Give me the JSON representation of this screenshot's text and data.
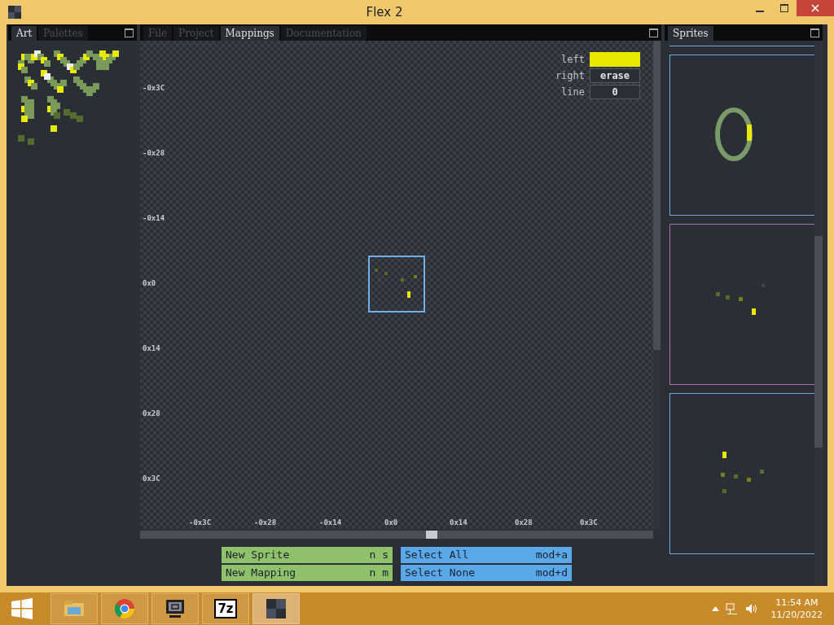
{
  "window": {
    "title": "Flex 2"
  },
  "left_panel": {
    "tabs": [
      {
        "label": "Art",
        "selected": true
      },
      {
        "label": "Palettes",
        "selected": false
      }
    ]
  },
  "center_panel": {
    "tabs": [
      {
        "label": "File",
        "selected": false
      },
      {
        "label": "Project",
        "selected": false
      },
      {
        "label": "Mappings",
        "selected": true
      },
      {
        "label": "Documentation",
        "selected": false
      }
    ],
    "y_axis_labels": [
      "-0x3C",
      "-0x28",
      "-0x14",
      "0x0",
      "0x14",
      "0x28",
      "0x3C"
    ],
    "x_axis_labels": [
      "-0x3C",
      "-0x28",
      "-0x14",
      "0x0",
      "0x14",
      "0x28",
      "0x3C"
    ],
    "brush": [
      {
        "label": "left",
        "kind": "color",
        "color": "#e8e800"
      },
      {
        "label": "right",
        "kind": "text",
        "value": "erase"
      },
      {
        "label": "line",
        "kind": "text",
        "value": "0"
      }
    ],
    "actions": [
      {
        "label": "New Sprite",
        "shortcut": "n s",
        "color": "#8fc06a"
      },
      {
        "label": "Select All",
        "shortcut": "mod+a",
        "color": "#5aa8e8"
      },
      {
        "label": "New Mapping",
        "shortcut": "n m",
        "color": "#8fc06a"
      },
      {
        "label": "Select None",
        "shortcut": "mod+d",
        "color": "#5aa8e8"
      }
    ]
  },
  "right_panel": {
    "tabs": [
      {
        "label": "Sprites",
        "selected": true
      }
    ],
    "sprites": [
      {
        "selected": false
      },
      {
        "selected": true
      },
      {
        "selected": false
      }
    ]
  },
  "taskbar": {
    "apps": [
      {
        "kind": "folder",
        "selected": false
      },
      {
        "kind": "browser",
        "selected": false
      },
      {
        "kind": "monitor",
        "selected": false
      },
      {
        "kind": "archiver",
        "label": "7z",
        "selected": false
      },
      {
        "kind": "flex",
        "selected": true
      }
    ],
    "time": "11:54 AM",
    "date": "11/20/2022"
  }
}
